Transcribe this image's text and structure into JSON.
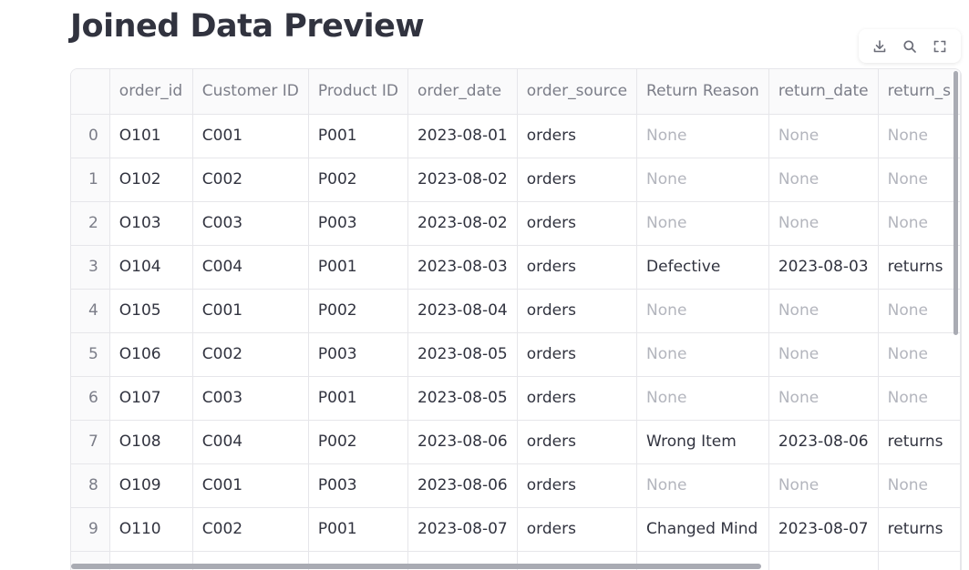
{
  "page": {
    "title": "Joined Data Preview"
  },
  "toolbar": {
    "download_icon": "download-icon",
    "search_icon": "search-icon",
    "fullscreen_icon": "fullscreen-icon"
  },
  "table": {
    "columns": [
      "",
      "order_id",
      "Customer ID",
      "Product ID",
      "order_date",
      "order_source",
      "Return Reason",
      "return_date",
      "return_s"
    ],
    "rows": [
      [
        "0",
        "O101",
        "C001",
        "P001",
        "2023-08-01",
        "orders",
        "None",
        "None",
        "None"
      ],
      [
        "1",
        "O102",
        "C002",
        "P002",
        "2023-08-02",
        "orders",
        "None",
        "None",
        "None"
      ],
      [
        "2",
        "O103",
        "C003",
        "P003",
        "2023-08-02",
        "orders",
        "None",
        "None",
        "None"
      ],
      [
        "3",
        "O104",
        "C004",
        "P001",
        "2023-08-03",
        "orders",
        "Defective",
        "2023-08-03",
        "returns"
      ],
      [
        "4",
        "O105",
        "C001",
        "P002",
        "2023-08-04",
        "orders",
        "None",
        "None",
        "None"
      ],
      [
        "5",
        "O106",
        "C002",
        "P003",
        "2023-08-05",
        "orders",
        "None",
        "None",
        "None"
      ],
      [
        "6",
        "O107",
        "C003",
        "P001",
        "2023-08-05",
        "orders",
        "None",
        "None",
        "None"
      ],
      [
        "7",
        "O108",
        "C004",
        "P002",
        "2023-08-06",
        "orders",
        "Wrong Item",
        "2023-08-06",
        "returns"
      ],
      [
        "8",
        "O109",
        "C001",
        "P003",
        "2023-08-06",
        "orders",
        "None",
        "None",
        "None"
      ],
      [
        "9",
        "O110",
        "C002",
        "P001",
        "2023-08-07",
        "orders",
        "Changed Mind",
        "2023-08-07",
        "returns"
      ],
      [
        "",
        "",
        "",
        "",
        "",
        "",
        "",
        "",
        ""
      ]
    ]
  }
}
